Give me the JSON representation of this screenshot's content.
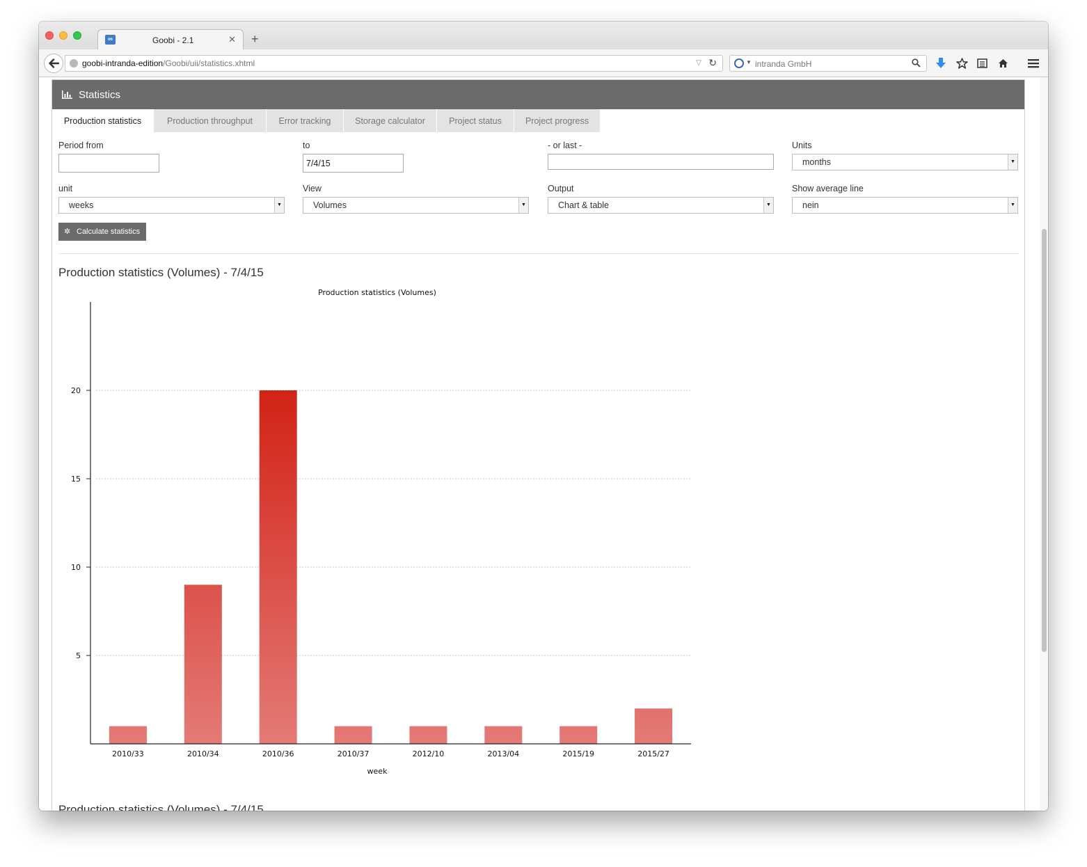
{
  "browser": {
    "tab_title": "Goobi - 2.1",
    "tab_favicon": "∞",
    "url_host": "goobi-intranda-edition",
    "url_path": "/Goobi/uii/statistics.xhtml",
    "search_placeholder": "intranda GmbH"
  },
  "page": {
    "panel_title": "Statistics",
    "tabs": [
      {
        "label": "Production statistics",
        "active": true
      },
      {
        "label": "Production throughput",
        "active": false
      },
      {
        "label": "Error tracking",
        "active": false
      },
      {
        "label": "Storage calculator",
        "active": false
      },
      {
        "label": "Project status",
        "active": false
      },
      {
        "label": "Project progress",
        "active": false
      }
    ],
    "form": {
      "period_from_label": "Period from",
      "period_from_value": "",
      "to_label": "to",
      "to_value": "7/4/15",
      "or_last_label": "- or last -",
      "or_last_value": "",
      "units_label": "Units",
      "units_value": "months",
      "unit_label": "unit",
      "unit_value": "weeks",
      "view_label": "View",
      "view_value": "Volumes",
      "output_label": "Output",
      "output_value": "Chart & table",
      "avg_label": "Show average line",
      "avg_value": "nein",
      "calculate_label": "Calculate statistics"
    },
    "result_title": "Production statistics (Volumes) - 7/4/15",
    "result_title_2": "Production statistics (Volumes) - 7/4/15"
  },
  "colors": {
    "bar_top": "#d22216",
    "bar_bottom": "#e47a76",
    "header_bg": "#6b6b6b"
  },
  "chart_data": {
    "type": "bar",
    "title": "Production statistics (Volumes)",
    "xlabel": "week",
    "ylabel": "",
    "categories": [
      "2010/33",
      "2010/34",
      "2010/36",
      "2010/37",
      "2012/10",
      "2013/04",
      "2015/19",
      "2015/27"
    ],
    "values": [
      1,
      9,
      20,
      1,
      1,
      1,
      1,
      2
    ],
    "ylim": [
      0,
      25
    ],
    "yticks": [
      5,
      10,
      15,
      20
    ],
    "grid": true,
    "legend": "none"
  }
}
